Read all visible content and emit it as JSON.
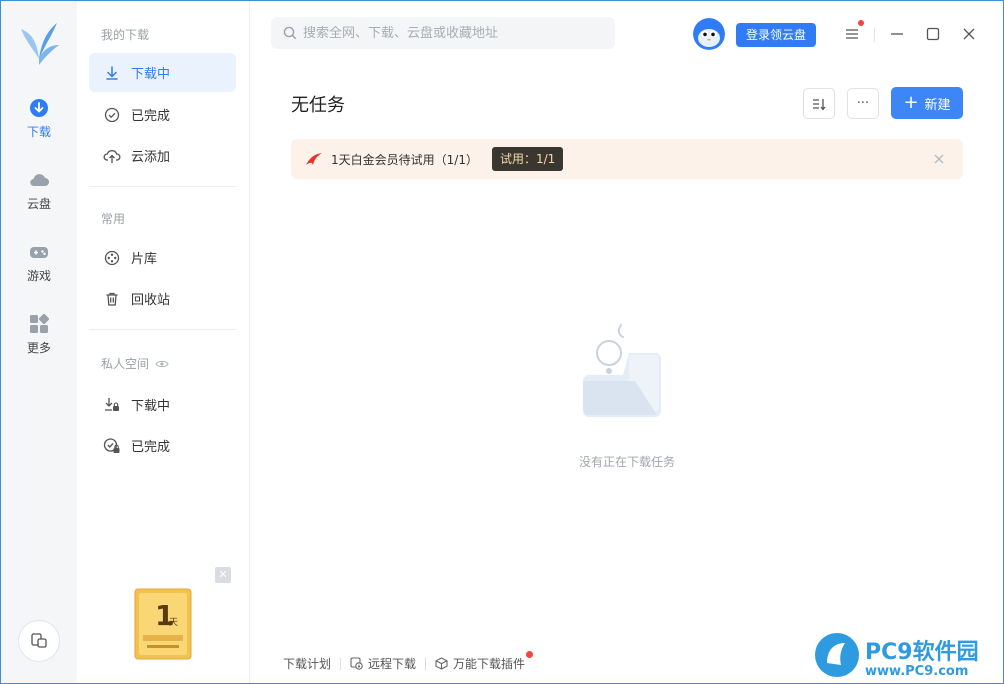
{
  "rail": {
    "items": [
      {
        "label": "下载",
        "icon": "download-icon",
        "active": true
      },
      {
        "label": "云盘",
        "icon": "cloud-icon",
        "active": false
      },
      {
        "label": "游戏",
        "icon": "gamepad-icon",
        "active": false
      },
      {
        "label": "更多",
        "icon": "apps-grid-icon",
        "active": false
      }
    ],
    "bottom_icon": "device-switch-icon"
  },
  "nav": {
    "section_downloads": "我的下载",
    "downloading": "下载中",
    "completed": "已完成",
    "cloud_add": "云添加",
    "section_common": "常用",
    "library": "片库",
    "recycle": "回收站",
    "section_private": "私人空间",
    "private_downloading": "下载中",
    "private_completed": "已完成",
    "promo_close": "✕"
  },
  "header": {
    "search_placeholder": "搜索全网、下载、云盘或收藏地址",
    "login_button": "登录领云盘"
  },
  "main": {
    "title": "无任务",
    "new_button": "新建",
    "more_button": "···",
    "banner_text": "1天白金会员待试用（1/1）",
    "banner_badge": "试用：1/1",
    "empty_text": "没有正在下载任务"
  },
  "footer": {
    "plan": "下载计划",
    "remote": "远程下载",
    "plugin": "万能下载插件"
  },
  "colors": {
    "accent": "#2f7cf6",
    "banner_bg": "#fdf2ea",
    "badge_bg": "#3a3630",
    "notification_dot": "#f2463b"
  }
}
